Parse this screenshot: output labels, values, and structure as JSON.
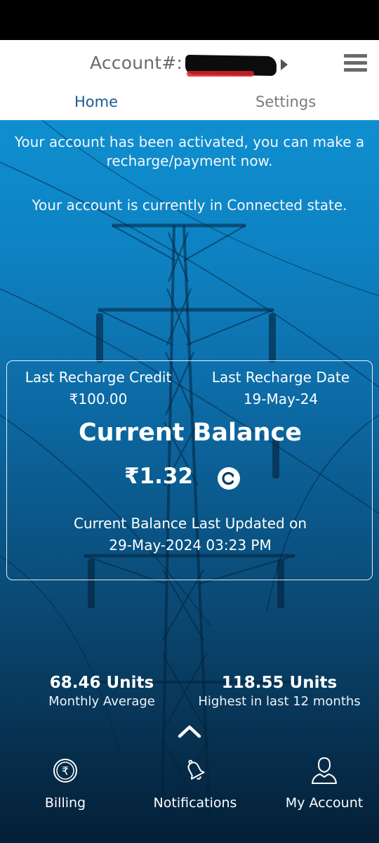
{
  "header": {
    "account_label": "Account#: 1",
    "tabs": [
      {
        "label": "Home",
        "active": true
      },
      {
        "label": "Settings",
        "active": false
      }
    ]
  },
  "notices": {
    "activated": "Your account has been activated, you can make a recharge/payment now.",
    "state": "Your account is currently in Connected state."
  },
  "balance_card": {
    "last_recharge_credit_label": "Last Recharge Credit",
    "last_recharge_credit_value": "₹100.00",
    "last_recharge_date_label": "Last Recharge Date",
    "last_recharge_date_value": "19-May-24",
    "current_balance_title": "Current Balance",
    "current_balance_value": "₹1.32",
    "updated_label": "Current Balance Last Updated on",
    "updated_value": "29-May-2024 03:23 PM"
  },
  "stats": [
    {
      "value": "68.46 Units",
      "label": "Monthly Average"
    },
    {
      "value": "118.55 Units",
      "label": "Highest in last 12 months"
    }
  ],
  "bottom_nav": {
    "billing": "Billing",
    "notifications": "Notifications",
    "my_account": "My Account"
  },
  "icons": {
    "menu": "hamburger-menu-icon",
    "refresh": "refresh-icon",
    "expand": "chevron-up-icon",
    "billing": "rupee-coin-icon",
    "notifications": "bell-icon",
    "account": "user-icon"
  },
  "colors": {
    "active_tab": "#1d5a8c",
    "inactive_tab": "#7a7a7a",
    "background_top": "#0f8fd0",
    "background_bottom": "#041f36"
  }
}
